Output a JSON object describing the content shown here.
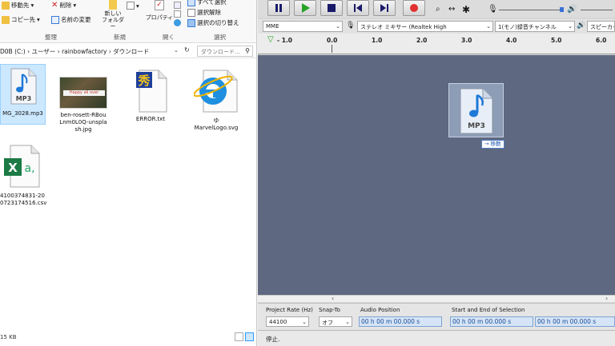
{
  "explorer": {
    "ribbon": {
      "move_to": "移動先",
      "delete": "削除",
      "copy_to": "コピー先",
      "rename": "名前の変更",
      "new_folder_line1": "新しい",
      "new_folder_line2": "フォルダー",
      "properties": "プロパティ",
      "select_all": "すべて選択",
      "select_none": "選択解除",
      "invert_selection": "選択の切り替え",
      "group_organize": "整理",
      "group_new": "新規",
      "group_open": "開く",
      "group_select": "選択"
    },
    "address": {
      "path": "D0B (C:)  ›  ユーザー  ›  rainbowfactory  ›  ダウンロード",
      "search_placeholder": "ダウンロード..."
    },
    "files": [
      {
        "name": "MG_3028.mp3",
        "icon": "mp3-file-icon",
        "selected": true
      },
      {
        "name": "ben-rosett-RBouLnm0L0Q-unsplash.jpg",
        "icon": "image-thumbnail",
        "selected": false
      },
      {
        "name": "ERROR.txt",
        "icon": "text-file-icon",
        "selected": false
      },
      {
        "name": "MarvelLogo.svg",
        "icon": "edge-browser-icon",
        "selected": false
      },
      {
        "name": "4100374831-2000723174516.csv",
        "icon": "excel-csv-icon",
        "selected": false
      }
    ],
    "file_labels": {
      "f0": "MG_3028.mp3",
      "f1a": "ben-rosett-RBou",
      "f1b": "Lnm0L0Q-unspla",
      "f1c": "sh.jpg",
      "f2": "ERROR.txt",
      "f3a": "ゆ",
      "f3b": "MarvelLogo.svg",
      "f4a": "4100374831-20",
      "f4b": "0723174516.csv"
    },
    "thumbnail_text": "Happy all over",
    "status_size": "15 KB"
  },
  "audacity": {
    "host": "MME",
    "input_device": "ステレオ ミキサー (Realtek High",
    "channels": "1(モノ)録音チャンネル",
    "output_device": "スピーカー (",
    "ruler": [
      "- 1.0",
      "0.0",
      "1.0",
      "2.0",
      "3.0",
      "4.0",
      "5.0",
      "6.0"
    ],
    "selection_toolbar": {
      "project_rate_label": "Project Rate (Hz)",
      "project_rate_value": "44100",
      "snap_to_label": "Snap-To",
      "snap_to_value": "オフ",
      "audio_position_label": "Audio Position",
      "audio_position_value": "00 h 00 m 00.000 s",
      "selection_label": "Start and End of Selection",
      "selection_start": "00 h 00 m 00.000 s",
      "selection_end": "00 h 00 m 00.000 s"
    },
    "status": "停止."
  },
  "drag": {
    "file_label": "MP3",
    "tooltip": "→ 移動"
  },
  "colors": {
    "track_background": "#5e6880",
    "play_green": "#2aa12a",
    "record_red": "#e03030",
    "selection_blue": "#cce8ff"
  }
}
